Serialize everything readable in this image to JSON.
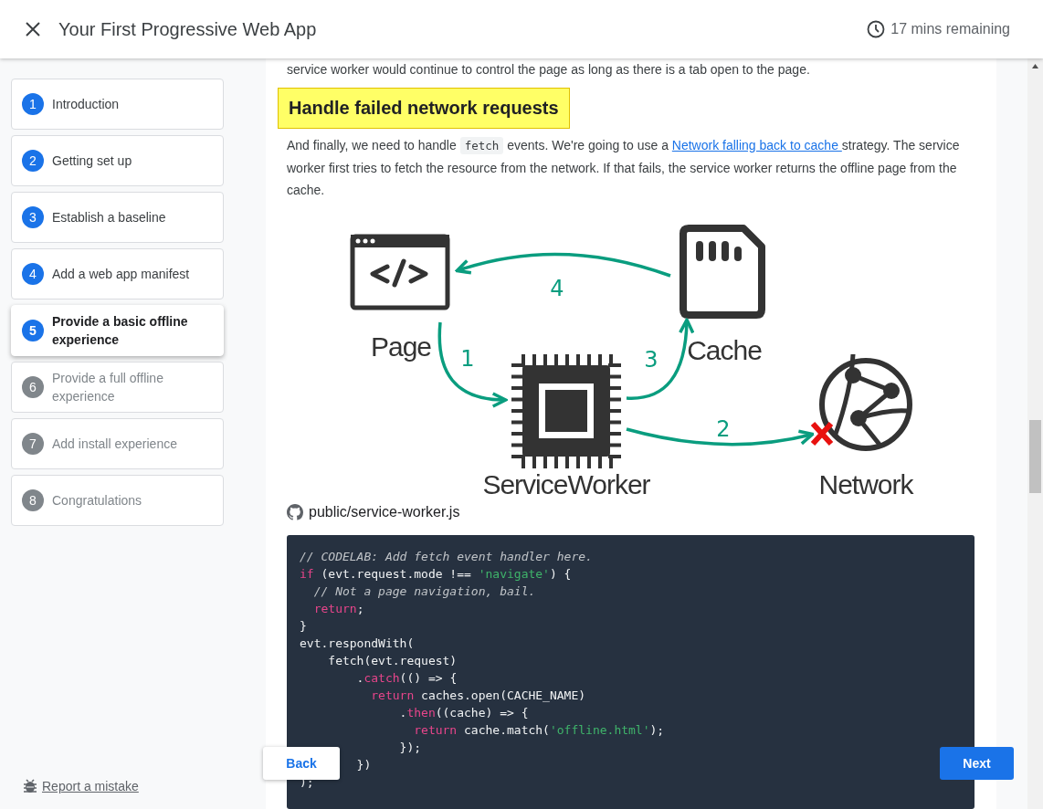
{
  "header": {
    "title": "Your First Progressive Web App",
    "time_remaining": "17 mins remaining"
  },
  "sidebar": {
    "steps": [
      {
        "number": "1",
        "label": "Introduction",
        "selected": false,
        "visited": true
      },
      {
        "number": "2",
        "label": "Getting set up",
        "selected": false,
        "visited": true
      },
      {
        "number": "3",
        "label": "Establish a baseline",
        "selected": false,
        "visited": true
      },
      {
        "number": "4",
        "label": "Add a web app manifest",
        "selected": false,
        "visited": true
      },
      {
        "number": "5",
        "label": "Provide a basic offline experience",
        "selected": true,
        "visited": true
      },
      {
        "number": "6",
        "label": "Provide a full offline experience",
        "selected": false,
        "visited": false
      },
      {
        "number": "7",
        "label": "Add install experience",
        "selected": false,
        "visited": false
      },
      {
        "number": "8",
        "label": "Congratulations",
        "selected": false,
        "visited": false
      }
    ],
    "report_link": "Report a mistake"
  },
  "content": {
    "intro_text": "service worker would continue to control the page as long as there is a tab open to the page.",
    "heading": "Handle failed network requests",
    "paragraph": [
      {
        "kind": "text",
        "text": "And finally, we need to handle "
      },
      {
        "kind": "code",
        "text": "fetch"
      },
      {
        "kind": "text",
        "text": " events. We're going to use a "
      },
      {
        "kind": "link",
        "text": "Network falling back to cache "
      },
      {
        "kind": "text",
        "text": "strategy. The service worker first tries to fetch the resource from the network. If that fails, the service worker returns the offline page from the cache."
      }
    ],
    "diagram": {
      "nodes": [
        {
          "kind": "page",
          "label": "Page"
        },
        {
          "kind": "cache",
          "label": "Cache"
        },
        {
          "kind": "worker",
          "label": "ServiceWorker"
        },
        {
          "kind": "network",
          "label": "Network",
          "failed": true
        }
      ],
      "steps": [
        "1",
        "2",
        "3",
        "4"
      ]
    },
    "file_label": "public/service-worker.js",
    "code_lines": [
      [
        {
          "kind": "comment",
          "text": "// CODELAB: Add fetch event handler here."
        }
      ],
      [
        {
          "kind": "keyword",
          "text": "if"
        },
        {
          "kind": "plain",
          "text": " (evt.request.mode !== "
        },
        {
          "kind": "string",
          "text": "'navigate'"
        },
        {
          "kind": "plain",
          "text": ") {"
        }
      ],
      [
        {
          "kind": "comment",
          "text": "  // Not a page navigation, bail."
        }
      ],
      [
        {
          "kind": "keyword",
          "text": "  return"
        },
        {
          "kind": "plain",
          "text": ";"
        }
      ],
      [
        {
          "kind": "plain",
          "text": "}"
        }
      ],
      [
        {
          "kind": "plain",
          "text": "evt.respondWith("
        }
      ],
      [
        {
          "kind": "plain",
          "text": "    fetch(evt.request)"
        }
      ],
      [
        {
          "kind": "plain",
          "text": "        ."
        },
        {
          "kind": "keyword",
          "text": "catch"
        },
        {
          "kind": "plain",
          "text": "(() => {"
        }
      ],
      [
        {
          "kind": "keyword",
          "text": "          return"
        },
        {
          "kind": "plain",
          "text": " caches.open(CACHE_NAME)"
        }
      ],
      [
        {
          "kind": "plain",
          "text": "              ."
        },
        {
          "kind": "keyword",
          "text": "then"
        },
        {
          "kind": "plain",
          "text": "((cache) => {"
        }
      ],
      [
        {
          "kind": "keyword",
          "text": "                return"
        },
        {
          "kind": "plain",
          "text": " cache.match("
        },
        {
          "kind": "string",
          "text": "'offline.html'"
        },
        {
          "kind": "plain",
          "text": ");"
        }
      ],
      [
        {
          "kind": "plain",
          "text": "              });"
        }
      ],
      [
        {
          "kind": "plain",
          "text": "        })"
        }
      ],
      [
        {
          "kind": "plain",
          "text": ");"
        }
      ]
    ]
  },
  "buttons": {
    "back": "Back",
    "next": "Next"
  }
}
